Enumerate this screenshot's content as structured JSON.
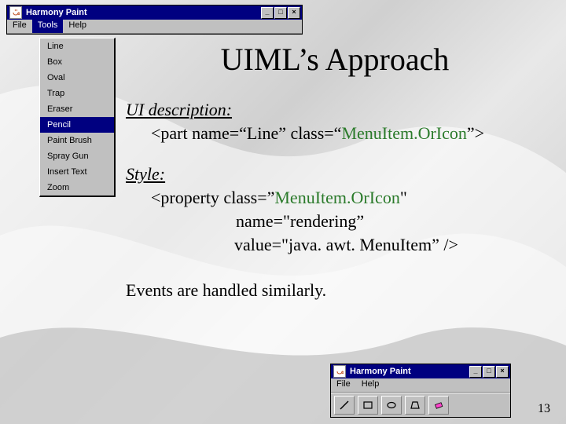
{
  "slide": {
    "title": "UIML’s Approach",
    "section1_label": "UI description:",
    "section1_code": "<part name=“Line” class=“MenuItem.OrIcon”>",
    "section2_label": "Style:",
    "section2_line1": "<property class=”MenuItem.OrIcon\"",
    "section2_line2": "name=\"rendering”",
    "section2_line3": "value=\"java. awt. MenuItem” />",
    "footer": "Events are handled similarly.",
    "page_number": "13"
  },
  "win_large": {
    "title": "Harmony Paint",
    "menu": {
      "file": "File",
      "tools": "Tools",
      "help": "Help"
    },
    "dropdown": [
      "Line",
      "Box",
      "Oval",
      "Trap",
      "Eraser",
      "Pencil",
      "Paint Brush",
      "Spray Gun",
      "Insert Text",
      "Zoom"
    ],
    "winctrl": {
      "min": "_",
      "max": "□",
      "close": "×"
    }
  },
  "win_small": {
    "title": "Harmony Paint",
    "menu": {
      "file": "File",
      "help": "Help"
    },
    "winctrl": {
      "min": "_",
      "max": "□",
      "close": "×"
    }
  }
}
